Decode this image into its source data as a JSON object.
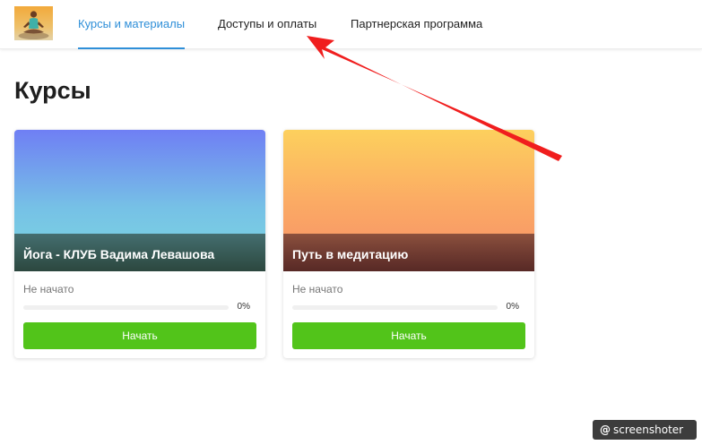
{
  "nav": {
    "items": [
      {
        "label": "Курсы и материалы",
        "active": true
      },
      {
        "label": "Доступы и оплаты",
        "active": false
      },
      {
        "label": "Партнерская программа",
        "active": false
      }
    ]
  },
  "page": {
    "title": "Курсы"
  },
  "courses": [
    {
      "title": "Йога - КЛУБ Вадима Левашова",
      "status": "Не начато",
      "progress_percent": 0,
      "progress_label": "0%",
      "button_label": "Начать"
    },
    {
      "title": "Путь в медитацию",
      "status": "Не начато",
      "progress_percent": 0,
      "progress_label": "0%",
      "button_label": "Начать"
    }
  ],
  "colors": {
    "accent": "#2f8fd8",
    "button": "#52c41a",
    "annotation_arrow": "#f01e1e"
  },
  "watermark": {
    "symbol": "@",
    "text": "screenshoter"
  }
}
